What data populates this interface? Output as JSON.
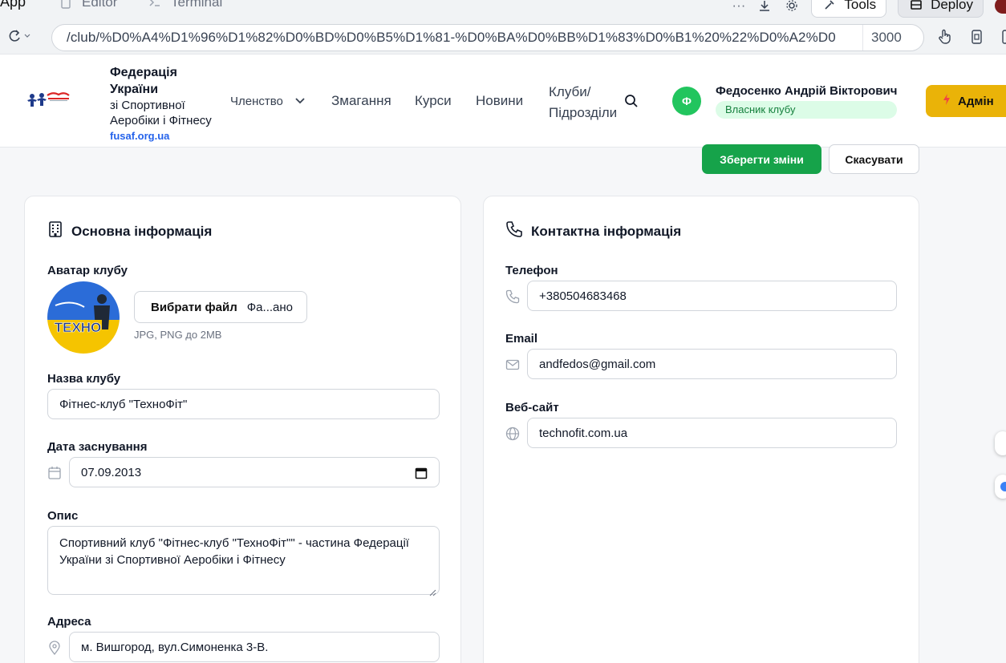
{
  "ide": {
    "app_label": "App",
    "tabs": [
      {
        "label": "Editor",
        "icon": "file-icon"
      },
      {
        "label": "Terminal",
        "icon": "terminal-icon"
      }
    ],
    "more_label": "···",
    "tools_label": "Tools",
    "deploy_label": "Deploy"
  },
  "browser": {
    "url": "/club/%D0%A4%D1%96%D1%82%D0%BD%D0%B5%D1%81-%D0%BA%D0%BB%D1%83%D0%B1%20%22%D0%A2%D0",
    "port": "3000"
  },
  "header": {
    "brand_line1": "Федерація",
    "brand_line2": "України",
    "brand_line3": "зі Спортивної",
    "brand_line4": "Аеробіки і Фітнесу",
    "brand_site": "fusaf.org.ua",
    "nav": {
      "membership": "Членство",
      "competitions": "Змагання",
      "courses": "Курси",
      "news": "Новини",
      "clubs_line1": "Клуби/",
      "clubs_line2": "Підрозділи"
    },
    "user_initial": "Ф",
    "user_name": "Федосенко Андрій Вікторович",
    "user_role": "Власник клубу",
    "admin_label": "Адмін"
  },
  "actions": {
    "save": "Зберегти зміни",
    "cancel": "Скасувати"
  },
  "basic": {
    "title": "Основна інформація",
    "avatar_label": "Аватар клубу",
    "avatar_text": "ТЕХНО",
    "file_button": "Вибрати файл",
    "file_status": "Фа...ано",
    "file_hint": "JPG, PNG до 2MB",
    "name_label": "Назва клубу",
    "name_value": "Фітнес-клуб \"ТехноФіт\"",
    "founded_label": "Дата заснування",
    "founded_value": "07.09.2013",
    "description_label": "Опис",
    "description_line1": "Спортивний клуб \"Фітнес-клуб \"ТехноФіт\"\" - частина Федерації",
    "description_line2": "України зі Спортивної Аеробіки і Фітнесу",
    "address_label": "Адреса",
    "address_value": "м. Вишгород, вул.Симоненка 3-В."
  },
  "contact": {
    "title": "Контактна інформація",
    "phone_label": "Телефон",
    "phone_value": "+380504683468",
    "email_label": "Email",
    "email_value": "andfedos@gmail.com",
    "website_label": "Веб-сайт",
    "website_value": "technofit.com.ua"
  },
  "colors": {
    "primary_green": "#16a34a",
    "admin_yellow": "#eab308",
    "link_blue": "#2563eb",
    "role_badge_bg": "#dcfce7"
  }
}
